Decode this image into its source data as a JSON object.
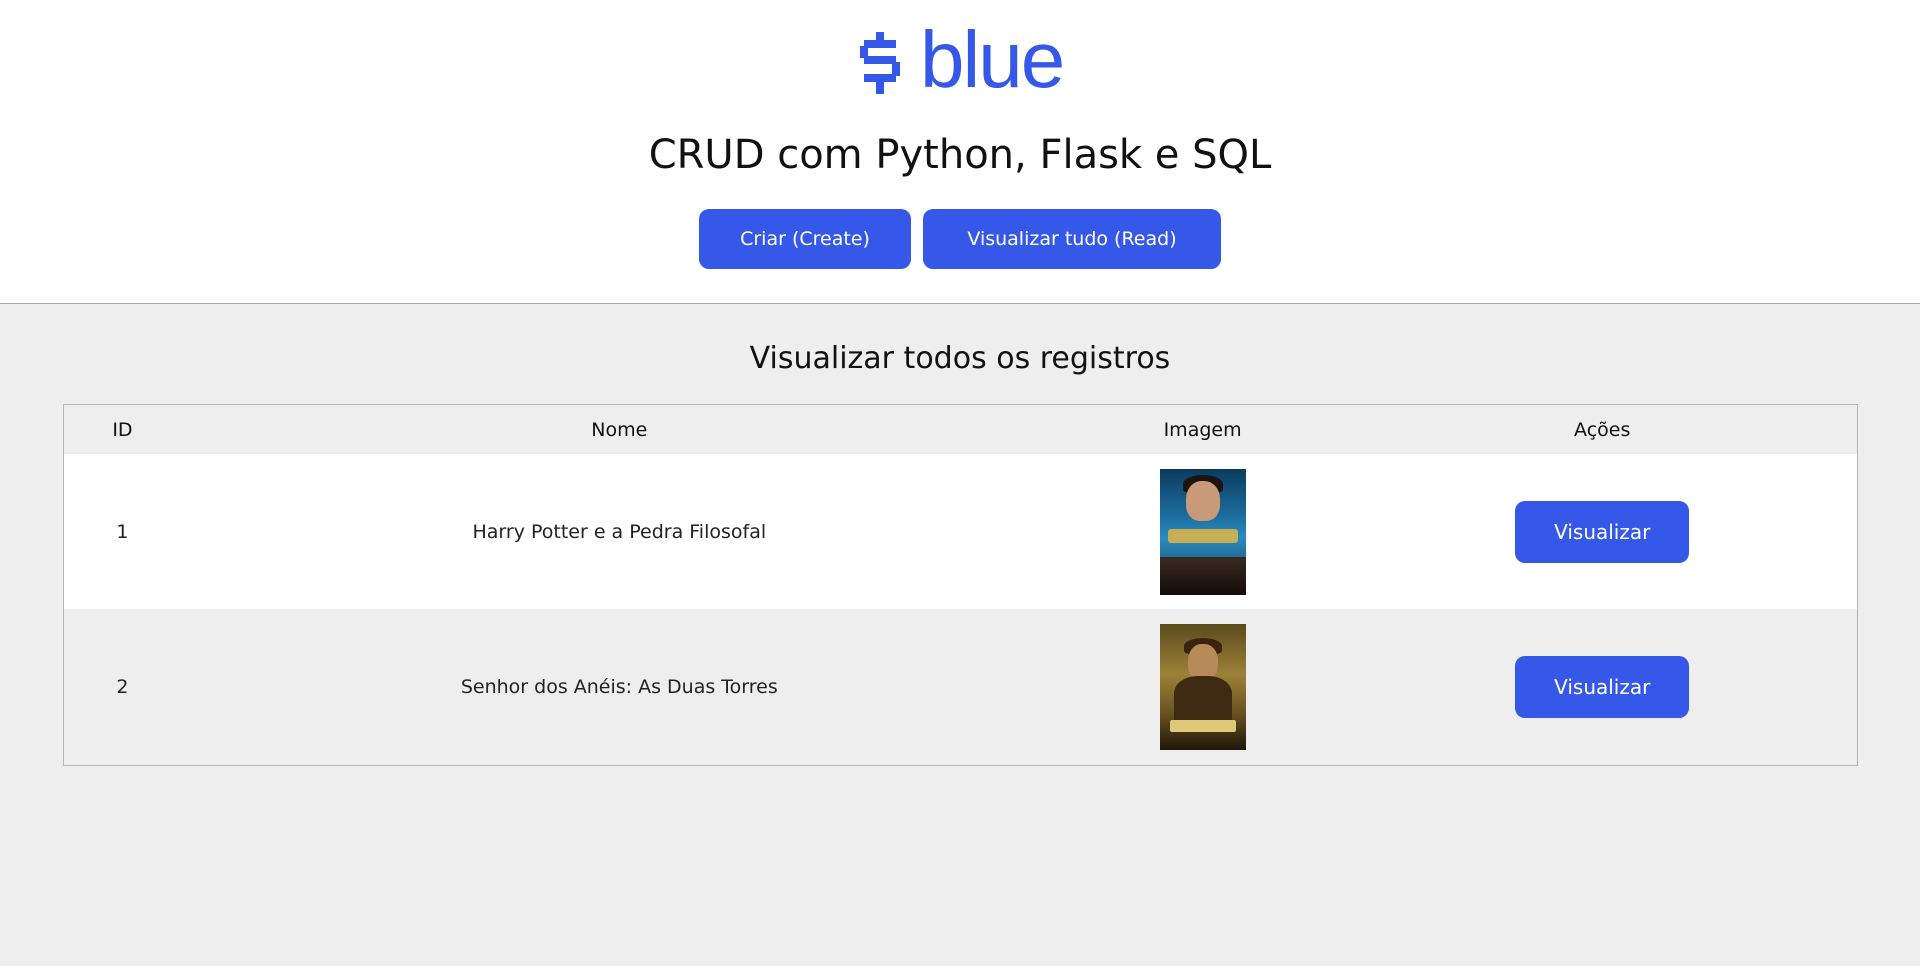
{
  "header": {
    "logo": {
      "mark": "dollar-icon",
      "text": "blue"
    },
    "title": "CRUD com Python, Flask e SQL",
    "buttons": {
      "create_label": "Criar (Create)",
      "read_label": "Visualizar tudo (Read)"
    }
  },
  "main": {
    "section_title": "Visualizar todos os registros",
    "table": {
      "columns": [
        "ID",
        "Nome",
        "Imagem",
        "Ações"
      ],
      "rows": [
        {
          "id": "1",
          "nome": "Harry Potter e a Pedra Filosofal",
          "image": "harry-potter-poster",
          "action_label": "Visualizar"
        },
        {
          "id": "2",
          "nome": "Senhor dos Anéis: As Duas Torres",
          "image": "harry-potter-chamber-poster",
          "action_label": "Visualizar"
        }
      ]
    }
  },
  "colors": {
    "accent": "#3658e8",
    "header_bg": "#ffffff",
    "content_bg": "#eeeeee",
    "row_alt_bg": "#ffffff"
  }
}
